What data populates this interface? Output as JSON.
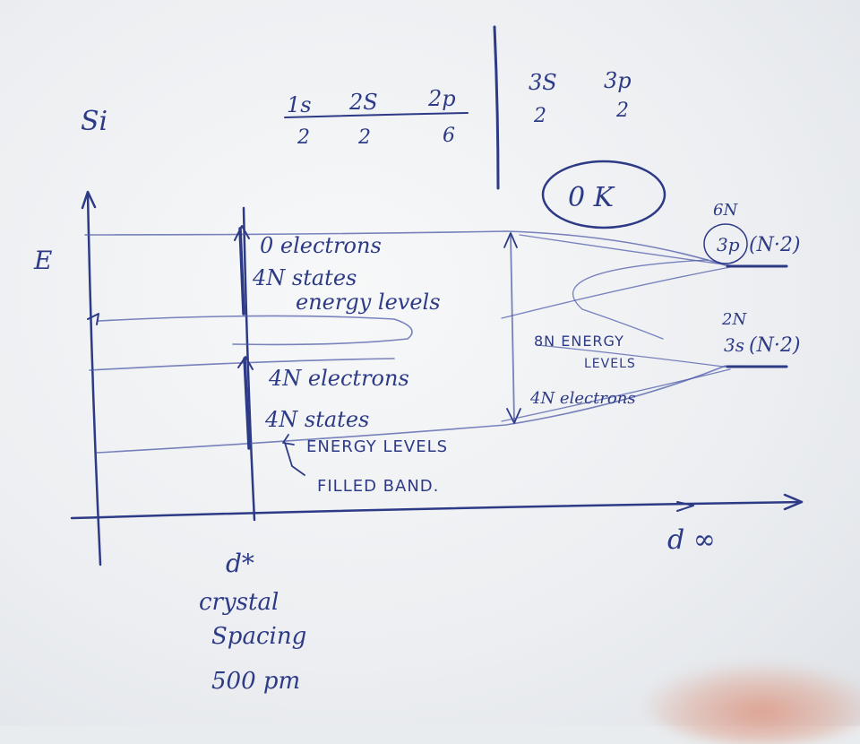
{
  "element": "Si",
  "config": {
    "core": [
      {
        "orbital": "1s",
        "count": "2"
      },
      {
        "orbital": "2S",
        "count": "2"
      },
      {
        "orbital": "2p",
        "count": "6"
      }
    ],
    "valence": [
      {
        "orbital": "3S",
        "count": "2"
      },
      {
        "orbital": "3p",
        "count": "2"
      }
    ]
  },
  "temperature": "0 K",
  "axes": {
    "y_label": "E",
    "x_label": "d ∞"
  },
  "spacing": {
    "marker": "d*",
    "line1": "crystal",
    "line2": "Spacing",
    "line3": "500 pm"
  },
  "upper_band": {
    "line1": "0 electrons",
    "line2": "4N states",
    "line3": "energy levels"
  },
  "lower_band": {
    "line1": "4N electrons",
    "line2": "4N states",
    "line3": "ENERGY LEVELS",
    "line4": "FILLED BAND."
  },
  "middle": {
    "line1": "8N ENERGY",
    "line2": "LEVELS",
    "line3": "4N electrons"
  },
  "level_3p": {
    "top": "6N",
    "label": "3p",
    "paren": "(N·2)"
  },
  "level_3s": {
    "top": "2N",
    "label": "3s",
    "paren": "(N·2)"
  }
}
